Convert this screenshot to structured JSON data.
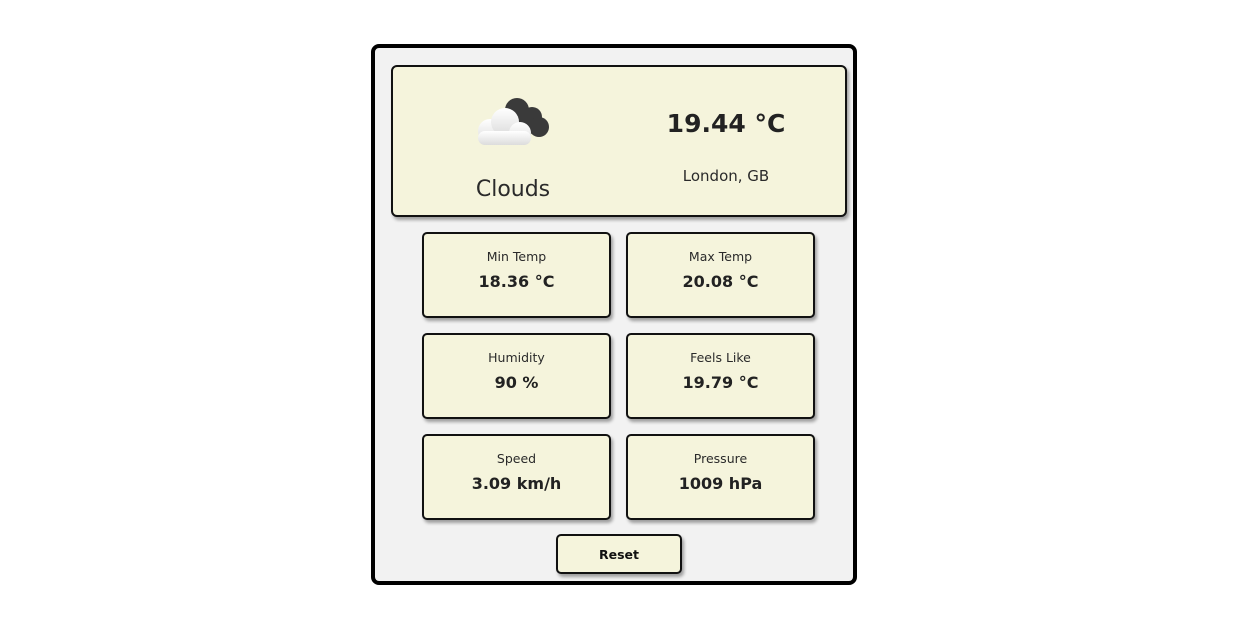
{
  "weather": {
    "condition": "Clouds",
    "temperature": "19.44 °C",
    "location": "London, GB",
    "icon": "cloud-icon"
  },
  "stats": {
    "min_temp": {
      "label": "Min Temp",
      "value": "18.36 °C"
    },
    "max_temp": {
      "label": "Max Temp",
      "value": "20.08 °C"
    },
    "humidity": {
      "label": "Humidity",
      "value": "90 %"
    },
    "feels_like": {
      "label": "Feels Like",
      "value": "19.79 °C"
    },
    "speed": {
      "label": "Speed",
      "value": "3.09 km/h"
    },
    "pressure": {
      "label": "Pressure",
      "value": "1009 hPa"
    }
  },
  "actions": {
    "reset_label": "Reset"
  },
  "colors": {
    "card_background": "#f5f4dc",
    "panel_background": "#f2f2f2",
    "border": "#111111"
  }
}
